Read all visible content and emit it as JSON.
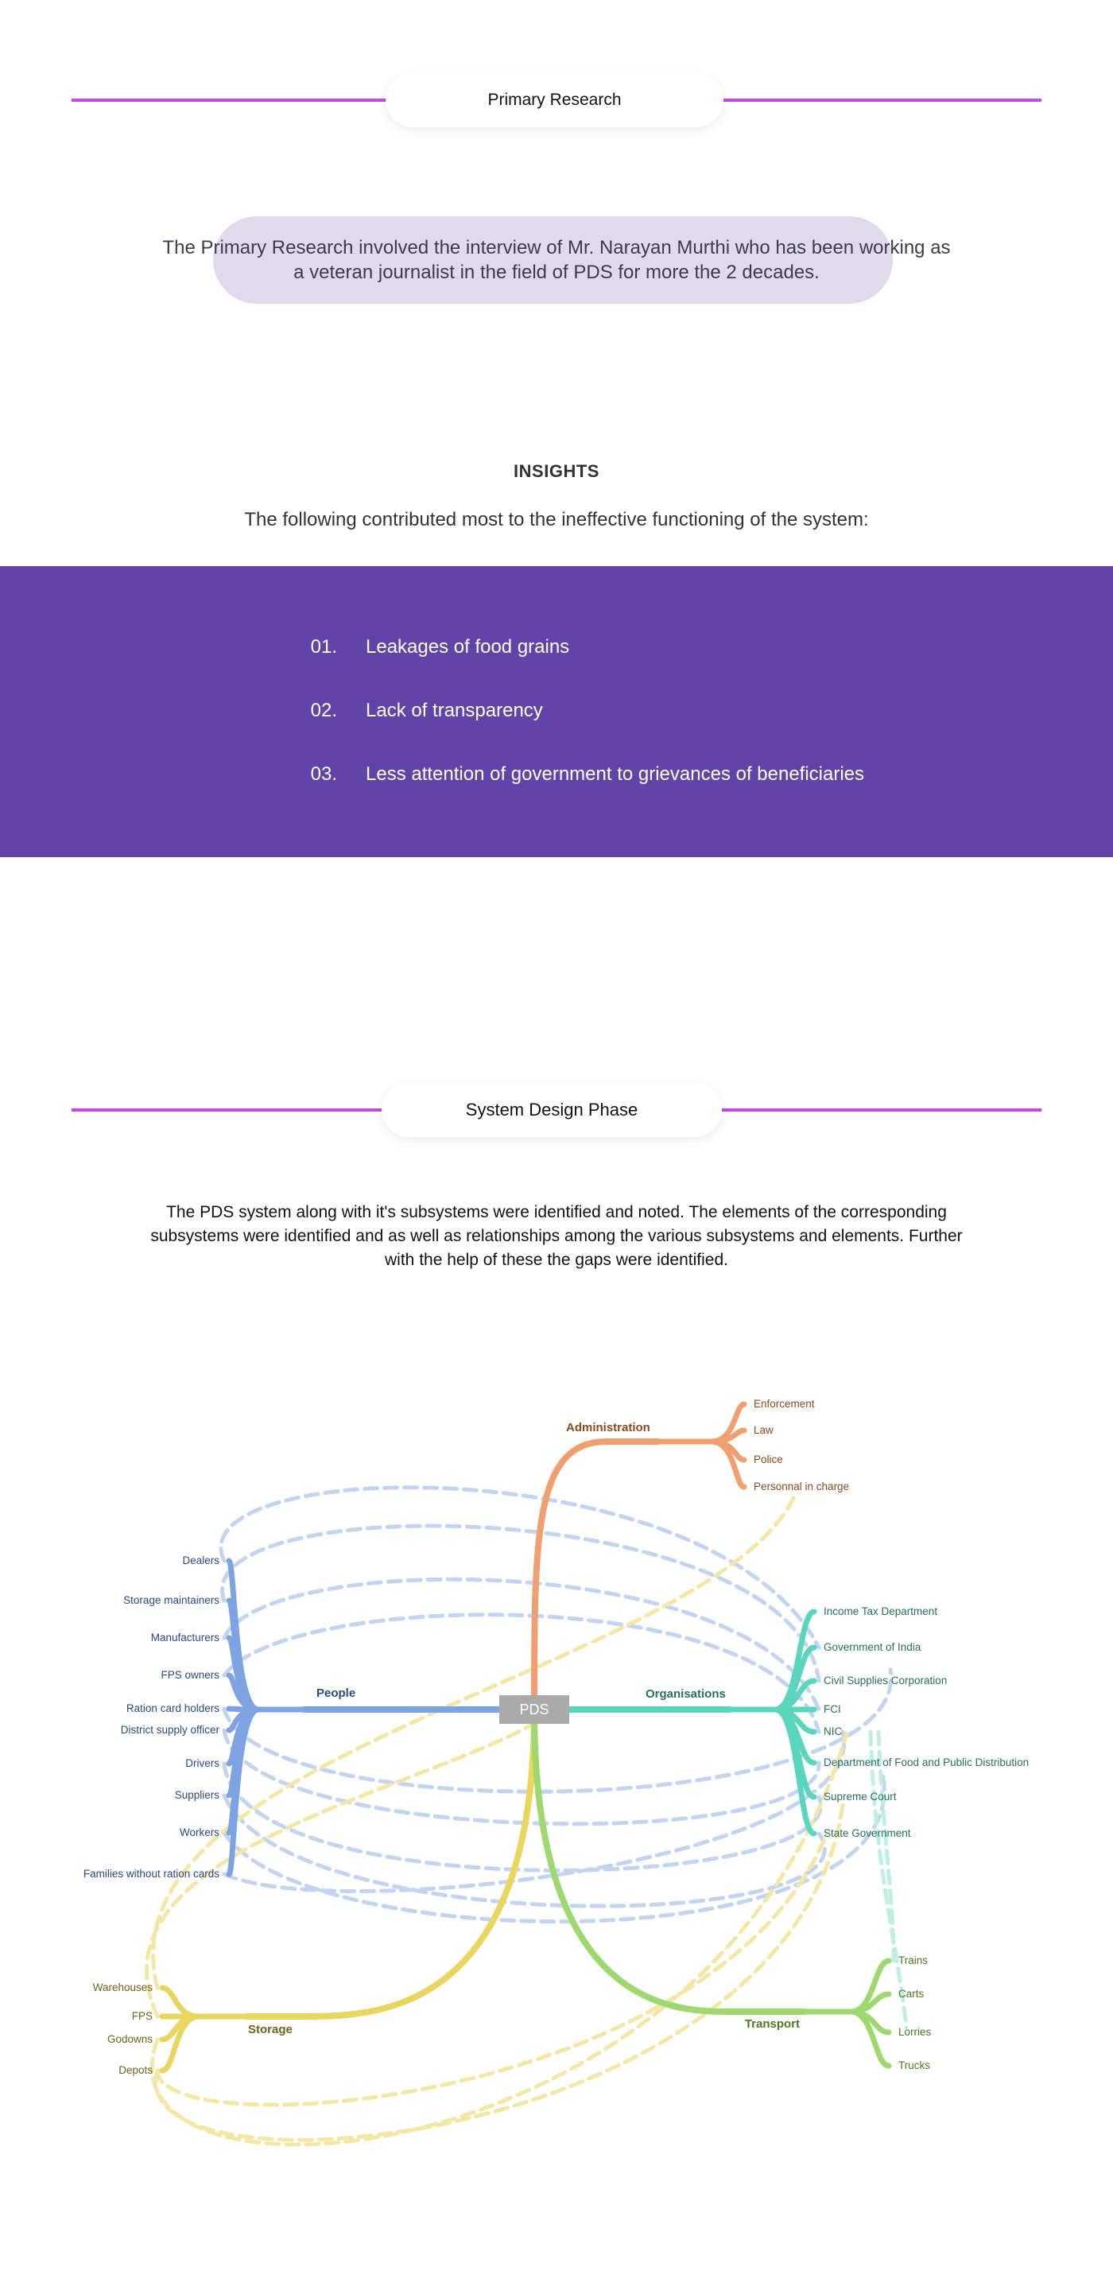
{
  "primary": {
    "title": "Primary Research",
    "intro": "The Primary Research involved the interview of Mr. Narayan Murthi who has been working as a veteran journalist in the field of PDS for more the 2 decades."
  },
  "insights": {
    "title": "INSIGHTS",
    "subtitle": "The following contributed most to the ineffective functioning of the system:",
    "items": [
      {
        "num": "01.",
        "text": "Leakages of food grains"
      },
      {
        "num": "02.",
        "text": "Lack of transparency"
      },
      {
        "num": "03.",
        "text": "Less attention of government to grievances of beneficiaries"
      }
    ]
  },
  "design": {
    "title": "System Design Phase",
    "text": "The PDS system along with it's subsystems were identified and noted. The elements of the corresponding subsystems were identified and as well as relationships among the various subsystems and elements. Further with the help of these the gaps were identified."
  },
  "mindmap": {
    "center": "PDS",
    "branches": [
      {
        "name": "Administration",
        "color": "#f0a070",
        "text_color": "#8a4a1c",
        "items": [
          "Enforcement",
          "Law",
          "Police",
          "Personnal in charge"
        ]
      },
      {
        "name": "People",
        "color": "#7ea3e3",
        "text_color": "#2a4a80",
        "items": [
          "Dealers",
          "Storage maintainers",
          "Manufacturers",
          "FPS owners",
          "Ration card holders",
          "District supply officer",
          "Drivers",
          "Suppliers",
          "Workers",
          "Families without ration cards"
        ]
      },
      {
        "name": "Organisations",
        "color": "#5ad6bd",
        "text_color": "#2a6e5e",
        "items": [
          "Income Tax Department",
          "Government of India",
          "Civil Supplies Corporation",
          "FCI",
          "NIC",
          "Department of Food and Public Distribution",
          "Supreme Court",
          "State Government"
        ]
      },
      {
        "name": "Storage",
        "color": "#e8d660",
        "text_color": "#6e6220",
        "items": [
          "Warehouses",
          "FPS",
          "Godowns",
          "Depots"
        ]
      },
      {
        "name": "Transport",
        "color": "#a0d870",
        "text_color": "#4a7a22",
        "items": [
          "Trains",
          "Carts",
          "Lorries",
          "Trucks"
        ]
      }
    ]
  }
}
